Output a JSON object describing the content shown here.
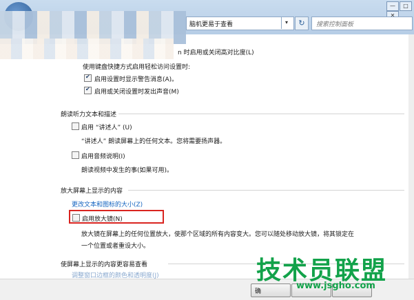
{
  "chrome": {
    "address": "脑机更易于查看",
    "address_dropdown": "▾",
    "refresh": "↻",
    "search_placeholder": "搜索控制面板",
    "window_buttons": [
      "—",
      "□",
      "✕"
    ]
  },
  "content": {
    "top_line": "n 时启用或关闭高对比度(L)",
    "shortcut_heading": "使用键盘快捷方式启用轻松访问设置时:",
    "opt_warning": "启用设置时显示警告消息(A)。",
    "opt_sound": "启用或关闭设置时发出声音(M)",
    "sec_narrator": "朗读听力文本和描述",
    "opt_narrator": "启用 “讲述人” (U)",
    "narrator_desc": "“讲述人” 朗读屏幕上的任何文本。您将需要扬声器。",
    "opt_audio_desc": "启用音频说明(I)",
    "audio_desc": "朗读视频中发生的事(如果可用)。",
    "sec_magnify": "放大屏幕上显示的内容",
    "link_text_size": "更改文本和图标的大小(Z)",
    "opt_magnifier": "启用放大镜(N)",
    "magnifier_desc1": "放大镜在屏幕上的任何位置放大，使那个区域的所有内容变大。您可以随处移动放大镜，将其锁定在",
    "magnifier_desc2": "一个位置或者重设大小。",
    "sec_visible": "使屏幕上显示的内容更容易查看",
    "link_window_color": "调整窗口边框的颜色和透明度(J)"
  },
  "footer": {
    "btn1": "确"
  },
  "watermark": {
    "name": "技术员联盟",
    "url": "www.jsgho.com"
  },
  "colors": {
    "link": "#1565c0",
    "highlight": "#d9231f",
    "watermark": "#12a24a"
  }
}
